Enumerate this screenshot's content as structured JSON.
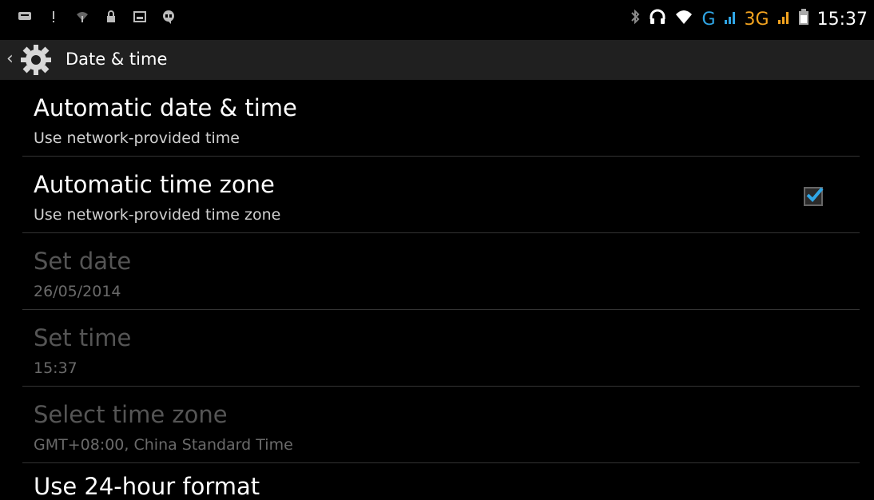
{
  "status_bar": {
    "time": "15:37",
    "network_g": "G",
    "network_3g": "3G"
  },
  "action_bar": {
    "title": "Date & time"
  },
  "settings": [
    {
      "title": "Automatic date & time",
      "summary": "Use network-provided time",
      "enabled": true,
      "checked": false
    },
    {
      "title": "Automatic time zone",
      "summary": "Use network-provided time zone",
      "enabled": true,
      "checked": true
    },
    {
      "title": "Set date",
      "summary": "26/05/2014",
      "enabled": false
    },
    {
      "title": "Set time",
      "summary": "15:37",
      "enabled": false
    },
    {
      "title": "Select time zone",
      "summary": "GMT+08:00, China Standard Time",
      "enabled": false
    }
  ],
  "partial_row": {
    "title": "Use 24-hour format"
  },
  "colors": {
    "accent": "#30a6e6",
    "background": "#000000",
    "action_bar": "#202020"
  }
}
